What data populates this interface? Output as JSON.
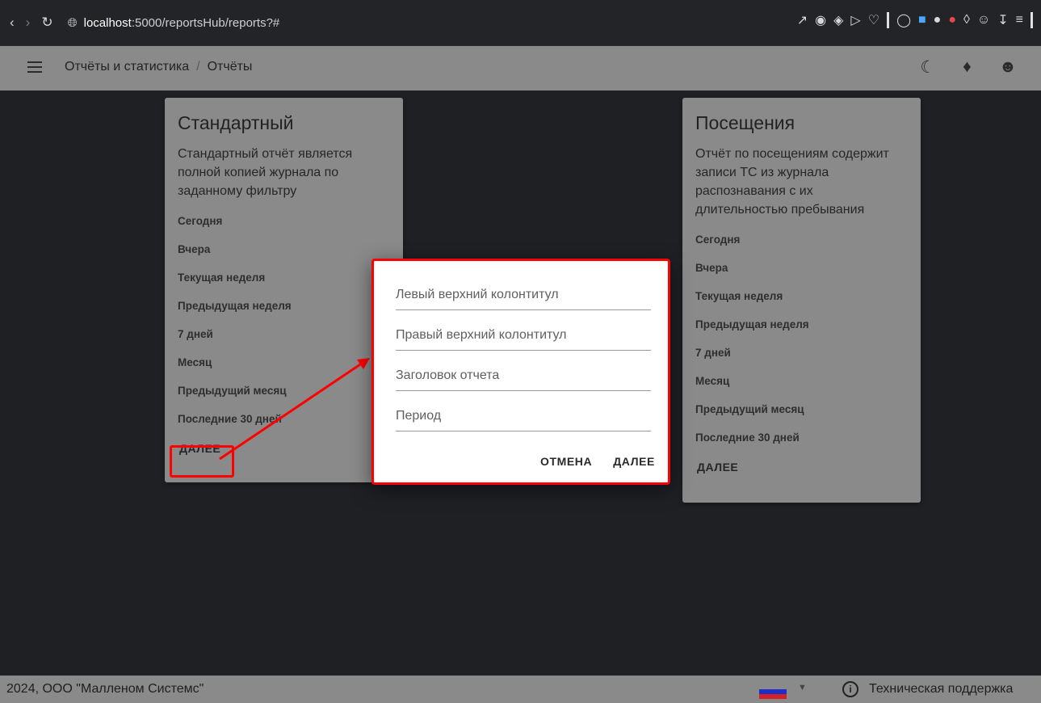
{
  "browser": {
    "url_host": "localhost",
    "url_path": ":5000/reportsHub/reports?#"
  },
  "header": {
    "breadcrumb_root": "Отчёты и статистика",
    "breadcrumb_separator": "/",
    "breadcrumb_current": "Отчёты"
  },
  "cards": [
    {
      "title": "Стандартный",
      "description": "Стандартный отчёт является полной копией журнала по заданному фильтру",
      "periods": [
        "Сегодня",
        "Вчера",
        "Текущая неделя",
        "Предыдущая неделя",
        "7 дней",
        "Месяц",
        "Предыдущий месяц",
        "Последние 30 дней"
      ],
      "next_label": "ДАЛЕЕ"
    },
    {
      "title": "Посещения",
      "description": "Отчёт по посещениям содержит записи ТС из журнала распознавания с их длительностью пребывания",
      "periods": [
        "Сегодня",
        "Вчера",
        "Текущая неделя",
        "Предыдущая неделя",
        "7 дней",
        "Месяц",
        "Предыдущий месяц",
        "Последние 30 дней"
      ],
      "next_label": "ДАЛЕЕ"
    }
  ],
  "dialog": {
    "fields": [
      {
        "placeholder": "Левый верхний колонтитул",
        "value": ""
      },
      {
        "placeholder": "Правый верхний колонтитул",
        "value": ""
      },
      {
        "placeholder": "Заголовок отчета",
        "value": ""
      },
      {
        "placeholder": "Период",
        "value": ""
      }
    ],
    "cancel_label": "ОТМЕНА",
    "next_label": "ДАЛЕЕ"
  },
  "footer": {
    "copyright": "2024, ООО \"Малленом Системс\"",
    "support_label": "Техническая поддержка"
  },
  "colors": {
    "highlight": "#ff0000",
    "card_bg": "#8a8a8a",
    "page_bg": "#1f2024"
  }
}
